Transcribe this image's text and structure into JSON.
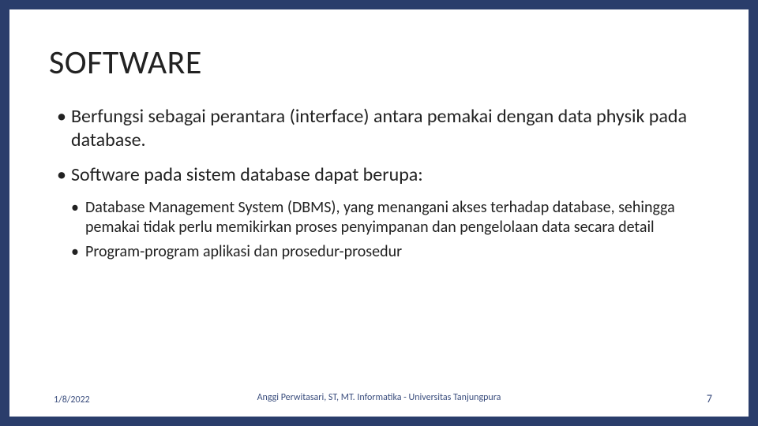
{
  "title": "SOFTWARE",
  "bullets": {
    "b1": "Berfungsi sebagai perantara (interface) antara pemakai dengan data physik pada database.",
    "b2": "Software pada sistem database dapat berupa:",
    "b2a": "Database Management System (DBMS), yang menangani akses terhadap database, sehingga pemakai tidak perlu memikirkan proses penyimpanan dan pengelolaan data secara detail",
    "b2b": "Program-program aplikasi dan prosedur-prosedur"
  },
  "footer": {
    "date": "1/8/2022",
    "center": "Anggi Perwitasari, ST, MT. Informatika - Universitas Tanjungpura",
    "page": "7"
  },
  "glyphs": {
    "bullet": "•"
  }
}
